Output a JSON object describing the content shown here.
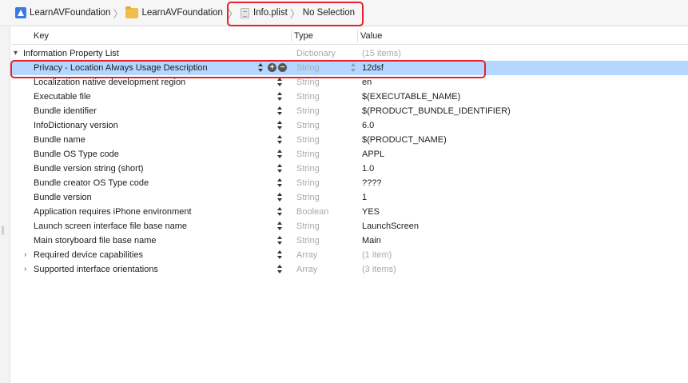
{
  "jumpbar": {
    "project": "LearnAVFoundation",
    "group": "LearnAVFoundation",
    "file": "Info.plist",
    "selection": "No Selection"
  },
  "columns": {
    "key": "Key",
    "type": "Type",
    "value": "Value"
  },
  "rows": [
    {
      "key": "Information Property List",
      "type": "Dictionary",
      "value": "(15 items)",
      "level": 0,
      "disclosure": "open"
    },
    {
      "key": "Privacy - Location Always Usage Description",
      "type": "String",
      "value": "12dsf",
      "level": 1,
      "selected": true
    },
    {
      "key": "Localization native development region",
      "type": "String",
      "value": "en",
      "level": 1
    },
    {
      "key": "Executable file",
      "type": "String",
      "value": "$(EXECUTABLE_NAME)",
      "level": 1
    },
    {
      "key": "Bundle identifier",
      "type": "String",
      "value": "$(PRODUCT_BUNDLE_IDENTIFIER)",
      "level": 1
    },
    {
      "key": "InfoDictionary version",
      "type": "String",
      "value": "6.0",
      "level": 1
    },
    {
      "key": "Bundle name",
      "type": "String",
      "value": "$(PRODUCT_NAME)",
      "level": 1
    },
    {
      "key": "Bundle OS Type code",
      "type": "String",
      "value": "APPL",
      "level": 1
    },
    {
      "key": "Bundle version string (short)",
      "type": "String",
      "value": "1.0",
      "level": 1
    },
    {
      "key": "Bundle creator OS Type code",
      "type": "String",
      "value": "????",
      "level": 1
    },
    {
      "key": "Bundle version",
      "type": "String",
      "value": "1",
      "level": 1
    },
    {
      "key": "Application requires iPhone environment",
      "type": "Boolean",
      "value": "YES",
      "level": 1
    },
    {
      "key": "Launch screen interface file base name",
      "type": "String",
      "value": "LaunchScreen",
      "level": 1
    },
    {
      "key": "Main storyboard file base name",
      "type": "String",
      "value": "Main",
      "level": 1
    },
    {
      "key": "Required device capabilities",
      "type": "Array",
      "value": "(1 item)",
      "level": 1,
      "disclosure": "closed"
    },
    {
      "key": "Supported interface orientations",
      "type": "Array",
      "value": "(3 items)",
      "level": 1,
      "disclosure": "closed"
    }
  ],
  "colors": {
    "selection": "#b3d7ff",
    "highlight_box": "#e8202d",
    "muted_text": "#a9a9a9"
  },
  "icons": {
    "disclosure_open": "▾",
    "disclosure_closed": "›",
    "add": "+",
    "remove": "−"
  }
}
